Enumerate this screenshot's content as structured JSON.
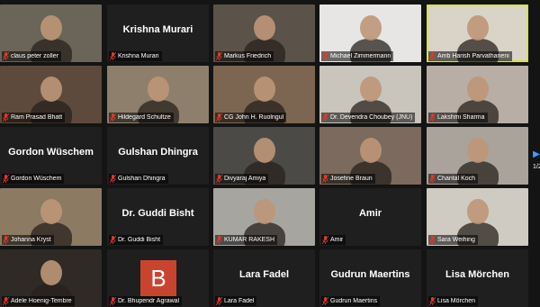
{
  "participants": [
    {
      "name": "claus peter zoller",
      "mode": "video",
      "bg": "#6b6458"
    },
    {
      "name": "Krishna Murari",
      "mode": "name",
      "display": "Krishna Murari"
    },
    {
      "name": "Markus Friedrich",
      "mode": "video",
      "bg": "#5b5249"
    },
    {
      "name": "Michael Zimmermann",
      "mode": "video",
      "bg": "#e7e6e4"
    },
    {
      "name": "Amb Harish Parvathaneni",
      "mode": "video",
      "bg": "#d9d3c8",
      "active": true
    },
    {
      "name": "Ram Prasad Bhatt",
      "mode": "video",
      "bg": "#5e4a3c"
    },
    {
      "name": "Hildegard Schultze",
      "mode": "video",
      "bg": "#8e7f6c"
    },
    {
      "name": "CG John H. Ruolngul",
      "mode": "video",
      "bg": "#7d6651"
    },
    {
      "name": "Dr. Devendra Choubey (JNU)",
      "mode": "video",
      "bg": "#c9c4bc"
    },
    {
      "name": "Lakshmi Sharma",
      "mode": "video",
      "bg": "#b8aea5"
    },
    {
      "name": "Gordon Wüschem",
      "mode": "name",
      "display": "Gordon Wüschem"
    },
    {
      "name": "Gulshan Dhingra",
      "mode": "name",
      "display": "Gulshan Dhingra"
    },
    {
      "name": "Divyaraj Amiya",
      "mode": "video",
      "bg": "#4c4a47"
    },
    {
      "name": "Josefine Braun",
      "mode": "video",
      "bg": "#7b6a5d"
    },
    {
      "name": "Chantal Koch",
      "mode": "video",
      "bg": "#a9a39b"
    },
    {
      "name": "Johanna Kryst",
      "mode": "video",
      "bg": "#8c7a63"
    },
    {
      "name": "Dr. Guddi Bisht",
      "mode": "name",
      "display": "Dr. Guddi Bisht"
    },
    {
      "name": "KUMAR RAKESH",
      "mode": "video",
      "bg": "#a7a59f"
    },
    {
      "name": "Amir",
      "mode": "name",
      "display": "Amir"
    },
    {
      "name": "Sara Weihing",
      "mode": "video",
      "bg": "#cfcac2"
    },
    {
      "name": "Adele Hoenig-Tembre",
      "mode": "video",
      "bg": "#2f2a26"
    },
    {
      "name": "Dr. Bhupendr Agrawal",
      "mode": "avatar",
      "avatar_letter": "B"
    },
    {
      "name": "Lara Fadel",
      "mode": "name",
      "display": "Lara Fadel"
    },
    {
      "name": "Gudrun Maertins",
      "mode": "name",
      "display": "Gudrun Maertins"
    },
    {
      "name": "Lisa Mörchen",
      "mode": "name",
      "display": "Lisa Mörchen"
    }
  ],
  "page_indicator": "1/2",
  "colors": {
    "accent": "#d6e34a",
    "muted_mic": "#e0392f",
    "avatar_bg": "#c9442e"
  }
}
